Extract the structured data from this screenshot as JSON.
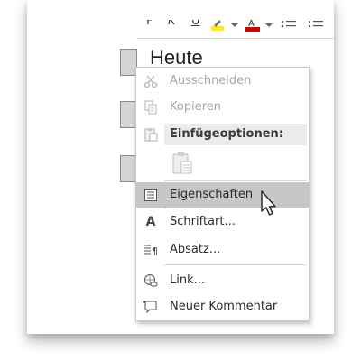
{
  "document": {
    "text": "Heute",
    "ribbon": {
      "bold": "F",
      "italic": "K",
      "underline": "U",
      "highlight_color": "#ffef00",
      "font_color": "#d00000"
    }
  },
  "context_menu": {
    "items": [
      {
        "label": "Ausschneiden",
        "icon": "scissors-icon",
        "enabled": false
      },
      {
        "label": "Kopieren",
        "icon": "copy-icon",
        "enabled": false
      },
      {
        "label": "Einfügeoptionen:",
        "icon": "clipboard-icon",
        "type": "section"
      },
      {
        "label": "Eigenschaften",
        "icon": "properties-icon",
        "highlighted": true
      },
      {
        "label": "Schriftart...",
        "icon": "font-icon"
      },
      {
        "label": "Absatz...",
        "icon": "paragraph-icon"
      },
      {
        "label": "Link...",
        "icon": "link-icon"
      },
      {
        "label": "Neuer Kommentar",
        "icon": "comment-icon"
      }
    ],
    "paste_option_icon": "paste-keep-text-icon"
  },
  "colors": {
    "highlight_bg": "#c6c6c6",
    "section_bg": "#ebebeb",
    "disabled_text": "#a7a7a7"
  }
}
